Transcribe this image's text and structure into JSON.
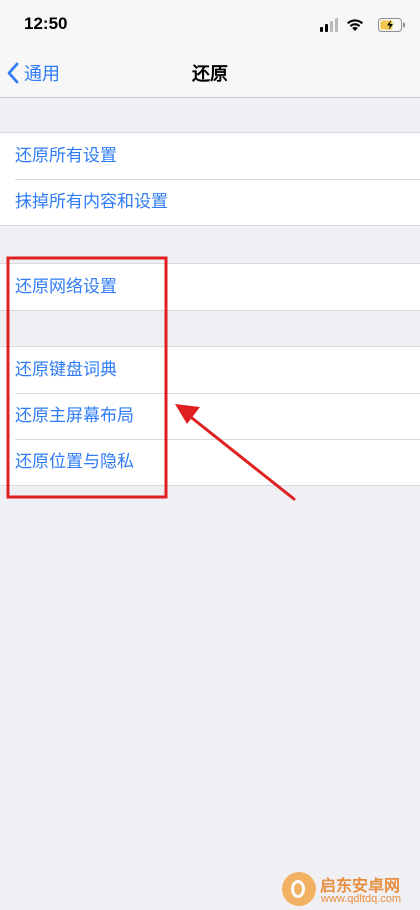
{
  "status_bar": {
    "time": "12:50",
    "icons": [
      "signal-icon",
      "wifi-icon",
      "battery-charging-icon"
    ]
  },
  "nav": {
    "back_label": "通用",
    "title": "还原"
  },
  "groups": [
    {
      "items": [
        "还原所有设置",
        "抹掉所有内容和设置"
      ]
    },
    {
      "items": [
        "还原网络设置"
      ]
    },
    {
      "items": [
        "还原键盘词典",
        "还原主屏幕布局",
        "还原位置与隐私"
      ]
    }
  ],
  "annotation": {
    "highlight_color": "#e02020",
    "arrow_color": "#e02020"
  },
  "watermark": {
    "name": "启东安卓网",
    "url": "www.qdltdq.com"
  },
  "colors": {
    "link_blue": "#2f7cf6",
    "background": "#efeff4"
  }
}
